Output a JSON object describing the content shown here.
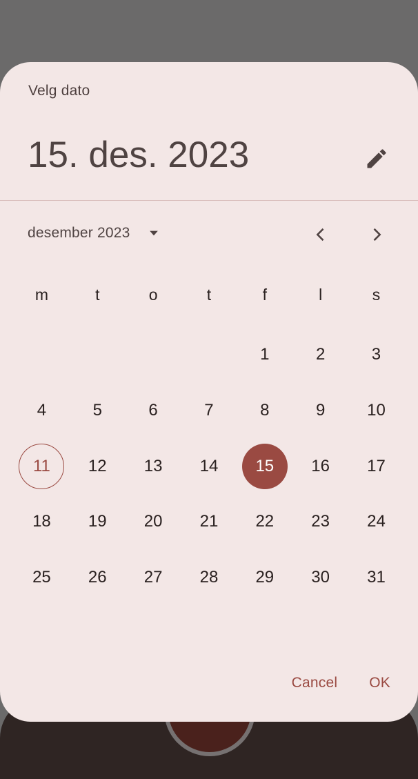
{
  "dialog": {
    "title": "Velg dato",
    "selected_date_text": "15. des. 2023",
    "month_label": "desember 2023",
    "weekdays": [
      "m",
      "t",
      "o",
      "t",
      "f",
      "l",
      "s"
    ],
    "weeks": [
      [
        "",
        "",
        "",
        "",
        "1",
        "2",
        "3"
      ],
      [
        "4",
        "5",
        "6",
        "7",
        "8",
        "9",
        "10"
      ],
      [
        "11",
        "12",
        "13",
        "14",
        "15",
        "16",
        "17"
      ],
      [
        "18",
        "19",
        "20",
        "21",
        "22",
        "23",
        "24"
      ],
      [
        "25",
        "26",
        "27",
        "28",
        "29",
        "30",
        "31"
      ]
    ],
    "today": "11",
    "selected": "15",
    "cancel_label": "Cancel",
    "ok_label": "OK"
  },
  "icons": {
    "edit": "pencil-icon",
    "dropdown": "caret-down-icon",
    "prev": "chevron-left-icon",
    "next": "chevron-right-icon"
  },
  "colors": {
    "accent": "#9a4a42",
    "surface": "#f3e7e6",
    "scrim": "#6b6a6a",
    "text": "#2a2120"
  }
}
